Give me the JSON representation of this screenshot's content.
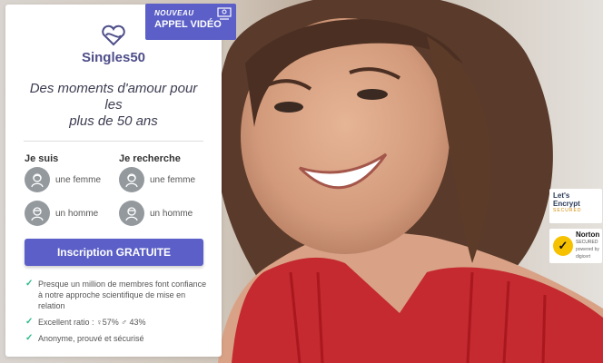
{
  "brand": {
    "name": "Singles50",
    "accent": "#5b5fc7"
  },
  "badge": {
    "small": "NOUVEAU",
    "big": "APPEL VIDÉO",
    "icon": "video-call-icon"
  },
  "tagline": [
    "Des moments d'amour pour",
    "les",
    "plus de 50 ans"
  ],
  "form": {
    "i_am_label": "Je suis",
    "seeking_label": "Je recherche",
    "i_am_options": [
      "une femme",
      "un homme"
    ],
    "seeking_options": [
      "une femme",
      "un homme"
    ]
  },
  "cta": {
    "label": "Inscription GRATUITE"
  },
  "benefits": [
    "Presque un million de membres font confiance à notre approche scientifique de mise en relation",
    "Excellent ratio : ♀57% ♂ 43%",
    "Anonyme, prouvé et sécurisé"
  ],
  "seals": {
    "letsencrypt": {
      "line1": "Let's",
      "line2": "Encrypt",
      "line3": "SECURED"
    },
    "norton": {
      "line1": "Norton",
      "line2": "SECURED",
      "line3": "powered by digicert"
    }
  }
}
